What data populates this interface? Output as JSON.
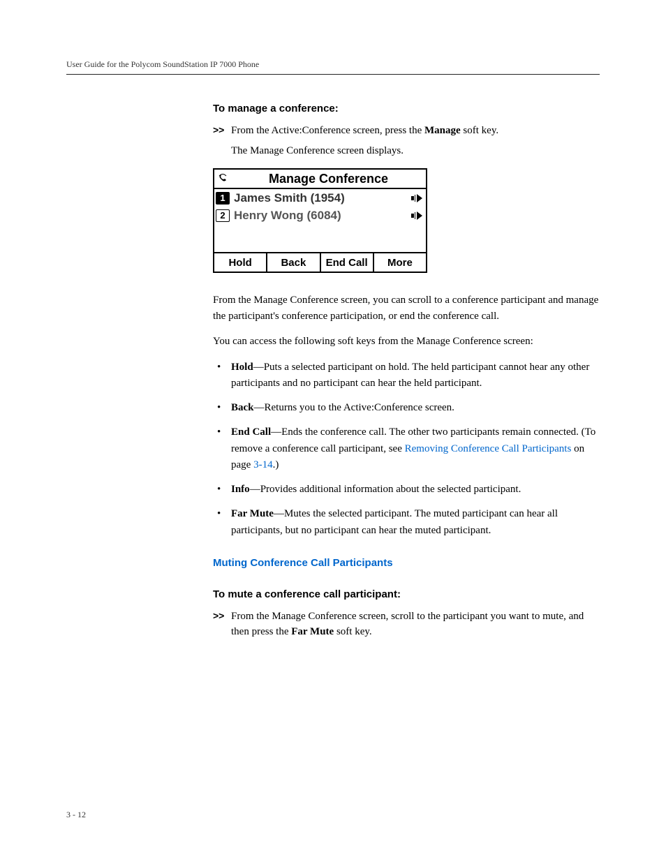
{
  "runningHead": "User Guide for the Polycom SoundStation IP 7000 Phone",
  "section1": {
    "heading": "To manage a conference:",
    "stepMarker": ">>",
    "stepLine1a": "From the Active:Conference screen, press the ",
    "stepLine1bold": "Manage",
    "stepLine1b": " soft key.",
    "stepLine2": "The Manage Conference screen displays."
  },
  "phoneScreen": {
    "title": "Manage Conference",
    "rows": [
      {
        "num": "1",
        "name": "James Smith (1954)",
        "selected": true
      },
      {
        "num": "2",
        "name": "Henry Wong (6084)",
        "selected": false
      }
    ],
    "softkeys": [
      "Hold",
      "Back",
      "End Call",
      "More"
    ]
  },
  "para1": "From the Manage Conference screen, you can scroll to a conference participant and manage the participant's conference participation, or end the conference call.",
  "para2": "You can access the following soft keys from the Manage Conference screen:",
  "bullets": {
    "b1": {
      "term": "Hold",
      "text": "—Puts a selected participant on hold. The held participant cannot hear any other participants and no participant can hear the held participant."
    },
    "b2": {
      "term": "Back",
      "text": "—Returns you to the Active:Conference screen."
    },
    "b3": {
      "term": "End Call",
      "textA": "—Ends the conference call. The other two participants remain connected. (To remove a conference call participant, see ",
      "link": "Removing Conference Call Participants",
      "textB": " on page ",
      "pageRef": "3-14",
      "textC": ".)"
    },
    "b4": {
      "term": "Info",
      "text": "—Provides additional information about the selected participant."
    },
    "b5": {
      "term": "Far Mute",
      "text": "—Mutes the selected participant. The muted participant can hear all participants, but no participant can hear the muted participant."
    }
  },
  "subHeading": "Muting Conference Call Participants",
  "section2": {
    "heading": "To mute a conference call participant:",
    "stepMarker": ">>",
    "stepA": "From the Manage Conference screen, scroll to the participant you want to mute, and then press the ",
    "stepBold": "Far Mute",
    "stepB": " soft key."
  },
  "pageNumber": "3 - 12"
}
